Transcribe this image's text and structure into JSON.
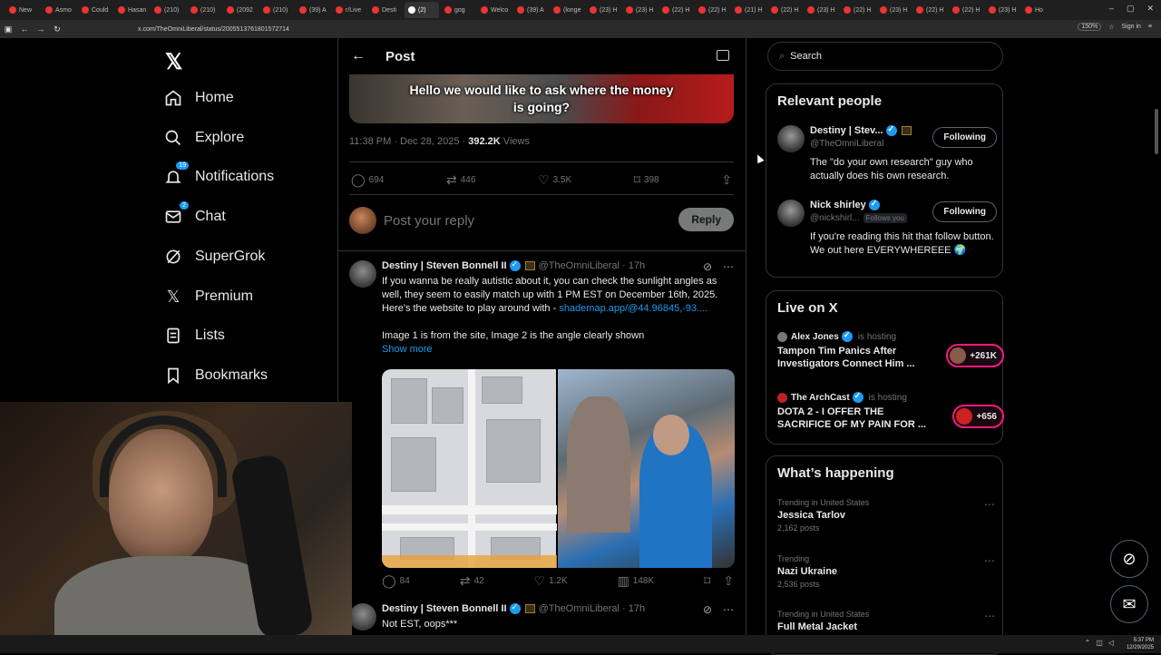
{
  "browser": {
    "tabs": [
      "New",
      "Asmo",
      "Could",
      "Hasan",
      "(210)",
      "(210)",
      "(2092",
      "(210)",
      "(39) A",
      "r/Live",
      "Desti",
      "(2)",
      "gog",
      "Welco",
      "(39) A",
      "(longe",
      "(23) H",
      "(23) H",
      "(22) H",
      "(22) H",
      "(21) H",
      "(22) H",
      "(23) H",
      "(22) H",
      "(23) H",
      "(22) H",
      "(22) H",
      "(23) H",
      "Ho"
    ],
    "url": "x.com/TheOmniLiberal/status/2005513761801572714",
    "zoom": "150%",
    "sign_in": "Sign in"
  },
  "nav": {
    "items": [
      {
        "label": "Home",
        "icon": "home-icon"
      },
      {
        "label": "Explore",
        "icon": "search-icon"
      },
      {
        "label": "Notifications",
        "icon": "bell-icon",
        "badge": "19"
      },
      {
        "label": "Chat",
        "icon": "mail-icon",
        "badge": "2"
      },
      {
        "label": "SuperGrok",
        "icon": "grok-icon"
      },
      {
        "label": "Premium",
        "icon": "x-logo-icon"
      },
      {
        "label": "Lists",
        "icon": "list-icon"
      },
      {
        "label": "Bookmarks",
        "icon": "bookmark-icon"
      }
    ]
  },
  "post": {
    "header_title": "Post",
    "video_caption": "Hello we would like to ask where the money is going?",
    "timestamp": "11:38 PM · Dec 28, 2025 · ",
    "views_count": "392.2K",
    "views_label": " Views",
    "stats": {
      "replies": "694",
      "reposts": "446",
      "likes": "3.5K",
      "bookmarks": "398"
    },
    "reply_placeholder": "Post your reply",
    "reply_button": "Reply"
  },
  "tweets": [
    {
      "name": "Destiny | Steven Bonnell II",
      "handle": "@TheOmniLiberal",
      "time": "· 17h",
      "text_1": "If you wanna be really autistic about it, you can check the sunlight angles as well, they seem to easily match up with 1 PM EST on December 16th, 2025. Here's the website to play around with - ",
      "link": "shademap.app/@44.96845,-93....",
      "text_2": "Image 1 is from the site, Image 2 is the angle clearly shown",
      "show_more": "Show more",
      "stats": {
        "replies": "84",
        "reposts": "42",
        "likes": "1.2K",
        "views": "148K"
      }
    },
    {
      "name": "Destiny | Steven Bonnell II",
      "handle": "@TheOmniLiberal",
      "time": "· 17h",
      "text_1": "Not EST, oops***"
    }
  ],
  "sidebar": {
    "search_placeholder": "Search",
    "relevant_title": "Relevant people",
    "people": [
      {
        "name": "Destiny | Stev...",
        "handle": "@TheOmniLiberal",
        "bio": "The \"do your own research\" guy who actually does his own research.",
        "button": "Following"
      },
      {
        "name": "Nick shirley",
        "handle": "@nickshirl...",
        "follows_you": "Follows you",
        "bio": "If you're reading this hit that follow button. We out here EVERYWHEREEE 🌍",
        "button": "Following"
      }
    ],
    "live_title": "Live on X",
    "live": [
      {
        "host": "Alex Jones",
        "hosting": "is hosting",
        "title": "Tampon Tim Panics After Investigators Connect Him ...",
        "count": "+261K"
      },
      {
        "host": "The ArchCast",
        "hosting": "is hosting",
        "title": "DOTA 2 - I OFFER THE SACRIFICE OF MY PAIN FOR ...",
        "count": "+656"
      }
    ],
    "happening_title": "What’s happening",
    "trends": [
      {
        "context": "Trending in United States",
        "name": "Jessica Tarlov",
        "count": "2,162 posts"
      },
      {
        "context": "Trending",
        "name": "Nazi Ukraine",
        "count": "2,536 posts"
      },
      {
        "context": "Trending in United States",
        "name": "Full Metal Jacket",
        "count": ""
      }
    ]
  },
  "taskbar": {
    "time": "5:37 PM",
    "date": "12/29/2025"
  },
  "colors": {
    "accent": "#1d9bf0",
    "live": "#f91880",
    "background": "#000000"
  }
}
